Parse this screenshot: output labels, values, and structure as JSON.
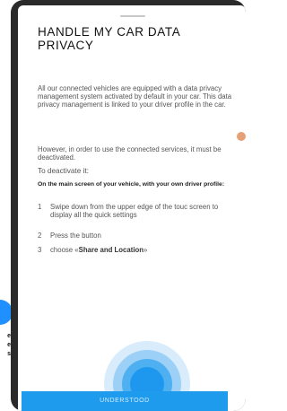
{
  "background_text": [
    "e",
    "e",
    "s"
  ],
  "modal": {
    "title": "HANDLE MY CAR DATA PRIVACY",
    "intro": "All our connected vehicles are equipped with a data privacy management system activated by default in your car. This data privacy management is linked to your driver profile in the car.",
    "however": "However, in order to use the connected services, it must be deactivated.",
    "to_deactivate": "To deactivate it:",
    "instruction_heading": "On the main screen of your vehicle, with your own driver profile:",
    "steps": [
      {
        "num": "1",
        "text": "Swipe down from the upper edge of the touc screen to display all the quick settings"
      },
      {
        "num": "2",
        "text": "Press the button"
      },
      {
        "num": "3",
        "text_prefix": "choose «",
        "text_bold": "Share and Location",
        "text_suffix": "»"
      }
    ],
    "button_label": "UNDERSTOOD"
  },
  "colors": {
    "accent": "#1e9bed",
    "frame": "#2a2a2a"
  }
}
